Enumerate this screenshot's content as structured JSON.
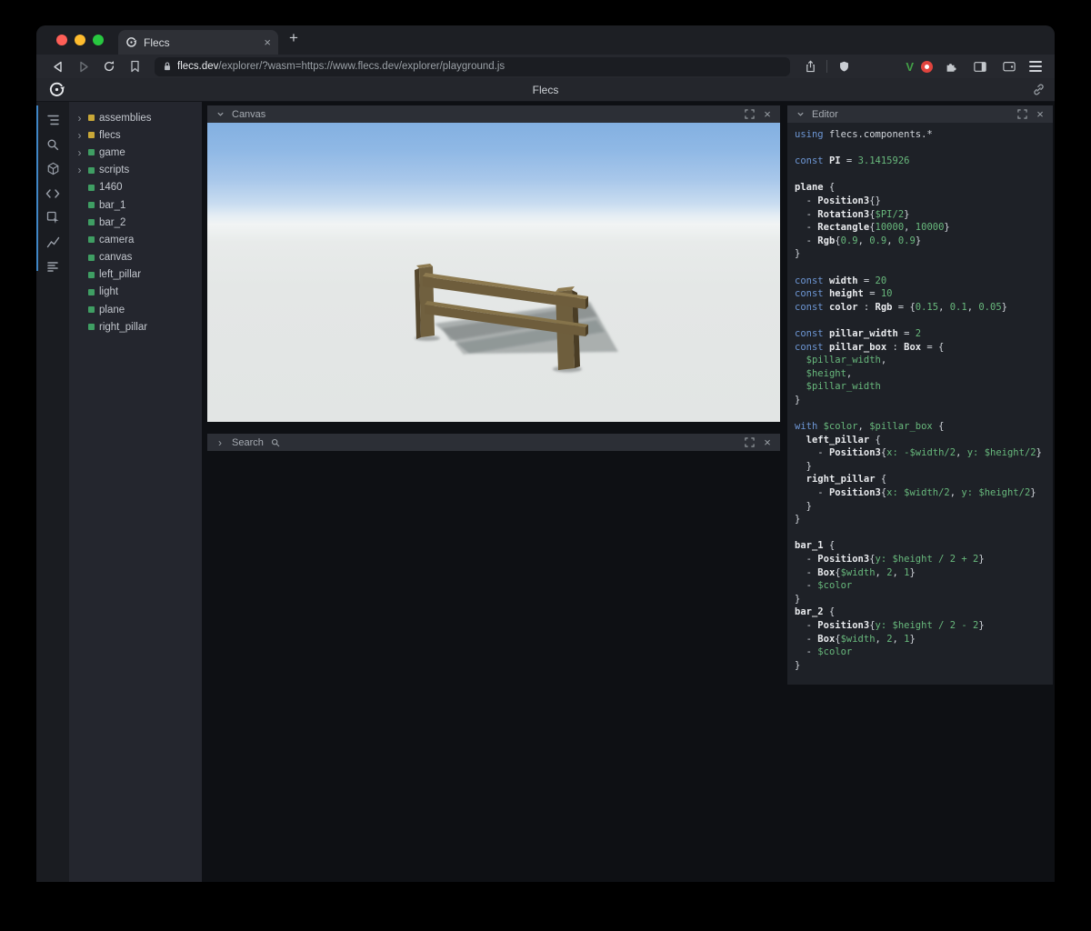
{
  "browser": {
    "tab_title": "Flecs",
    "url_host": "flecs.dev",
    "url_path": "/explorer/?wasm=https://www.flecs.dev/explorer/playground.js"
  },
  "glyphs": {
    "close": "×",
    "plus": "+",
    "chevron_right": "›"
  },
  "extensions": {
    "v_label": "V"
  },
  "header": {
    "title": "Flecs"
  },
  "sidebar_icon_names": [
    "outliner-icon",
    "search-icon",
    "entities-icon",
    "code-icon",
    "inspector-icon",
    "chart-icon",
    "stats-icon"
  ],
  "panels": {
    "canvas": {
      "title": "Canvas"
    },
    "search": {
      "title": "Search"
    },
    "editor": {
      "title": "Editor"
    }
  },
  "tree": {
    "items": [
      {
        "label": "assemblies",
        "color": "yellow",
        "expandable": true
      },
      {
        "label": "flecs",
        "color": "yellow",
        "expandable": true
      },
      {
        "label": "game",
        "color": "green",
        "expandable": true
      },
      {
        "label": "scripts",
        "color": "green",
        "expandable": true
      },
      {
        "label": "1460",
        "color": "green",
        "expandable": false
      },
      {
        "label": "bar_1",
        "color": "green",
        "expandable": false
      },
      {
        "label": "bar_2",
        "color": "green",
        "expandable": false
      },
      {
        "label": "camera",
        "color": "green",
        "expandable": false
      },
      {
        "label": "canvas",
        "color": "green",
        "expandable": false
      },
      {
        "label": "left_pillar",
        "color": "green",
        "expandable": false
      },
      {
        "label": "light",
        "color": "green",
        "expandable": false
      },
      {
        "label": "plane",
        "color": "green",
        "expandable": false
      },
      {
        "label": "right_pillar",
        "color": "green",
        "expandable": false
      }
    ]
  },
  "editor": {
    "lines": [
      [
        [
          "k",
          "using "
        ],
        [
          "p",
          "flecs.components.*"
        ]
      ],
      [],
      [
        [
          "k",
          "const "
        ],
        [
          "b",
          "PI"
        ],
        [
          "p",
          " = "
        ],
        [
          "v",
          "3.1415926"
        ]
      ],
      [],
      [
        [
          "b",
          "plane"
        ],
        [
          "p",
          " {"
        ]
      ],
      [
        [
          "p",
          "  - "
        ],
        [
          "b",
          "Position3"
        ],
        [
          "p",
          "{}"
        ]
      ],
      [
        [
          "p",
          "  - "
        ],
        [
          "b",
          "Rotation3"
        ],
        [
          "p",
          "{"
        ],
        [
          "v",
          "$PI/2"
        ],
        [
          "p",
          "}"
        ]
      ],
      [
        [
          "p",
          "  - "
        ],
        [
          "b",
          "Rectangle"
        ],
        [
          "p",
          "{"
        ],
        [
          "v",
          "10000"
        ],
        [
          "p",
          ", "
        ],
        [
          "v",
          "10000"
        ],
        [
          "p",
          "}"
        ]
      ],
      [
        [
          "p",
          "  - "
        ],
        [
          "b",
          "Rgb"
        ],
        [
          "p",
          "{"
        ],
        [
          "v",
          "0.9"
        ],
        [
          "p",
          ", "
        ],
        [
          "v",
          "0.9"
        ],
        [
          "p",
          ", "
        ],
        [
          "v",
          "0.9"
        ],
        [
          "p",
          "}"
        ]
      ],
      [
        [
          "p",
          "}"
        ]
      ],
      [],
      [
        [
          "k",
          "const "
        ],
        [
          "b",
          "width"
        ],
        [
          "p",
          " = "
        ],
        [
          "v",
          "20"
        ]
      ],
      [
        [
          "k",
          "const "
        ],
        [
          "b",
          "height"
        ],
        [
          "p",
          " = "
        ],
        [
          "v",
          "10"
        ]
      ],
      [
        [
          "k",
          "const "
        ],
        [
          "b",
          "color"
        ],
        [
          "p",
          " : "
        ],
        [
          "b",
          "Rgb"
        ],
        [
          "p",
          " = {"
        ],
        [
          "v",
          "0.15"
        ],
        [
          "p",
          ", "
        ],
        [
          "v",
          "0.1"
        ],
        [
          "p",
          ", "
        ],
        [
          "v",
          "0.05"
        ],
        [
          "p",
          "}"
        ]
      ],
      [],
      [
        [
          "k",
          "const "
        ],
        [
          "b",
          "pillar_width"
        ],
        [
          "p",
          " = "
        ],
        [
          "v",
          "2"
        ]
      ],
      [
        [
          "k",
          "const "
        ],
        [
          "b",
          "pillar_box"
        ],
        [
          "p",
          " : "
        ],
        [
          "b",
          "Box"
        ],
        [
          "p",
          " = {"
        ]
      ],
      [
        [
          "p",
          "  "
        ],
        [
          "v",
          "$pillar_width"
        ],
        [
          "p",
          ","
        ]
      ],
      [
        [
          "p",
          "  "
        ],
        [
          "v",
          "$height"
        ],
        [
          "p",
          ","
        ]
      ],
      [
        [
          "p",
          "  "
        ],
        [
          "v",
          "$pillar_width"
        ]
      ],
      [
        [
          "p",
          "}"
        ]
      ],
      [],
      [
        [
          "k",
          "with "
        ],
        [
          "v",
          "$color"
        ],
        [
          "p",
          ", "
        ],
        [
          "v",
          "$pillar_box"
        ],
        [
          "p",
          " {"
        ]
      ],
      [
        [
          "p",
          "  "
        ],
        [
          "b",
          "left_pillar"
        ],
        [
          "p",
          " {"
        ]
      ],
      [
        [
          "p",
          "    - "
        ],
        [
          "b",
          "Position3"
        ],
        [
          "p",
          "{"
        ],
        [
          "v",
          "x:"
        ],
        [
          "p",
          " "
        ],
        [
          "v",
          "-$width/2"
        ],
        [
          "p",
          ", "
        ],
        [
          "v",
          "y:"
        ],
        [
          "p",
          " "
        ],
        [
          "v",
          "$height/2"
        ],
        [
          "p",
          "}"
        ]
      ],
      [
        [
          "p",
          "  }"
        ]
      ],
      [
        [
          "p",
          "  "
        ],
        [
          "b",
          "right_pillar"
        ],
        [
          "p",
          " {"
        ]
      ],
      [
        [
          "p",
          "    - "
        ],
        [
          "b",
          "Position3"
        ],
        [
          "p",
          "{"
        ],
        [
          "v",
          "x:"
        ],
        [
          "p",
          " "
        ],
        [
          "v",
          "$width/2"
        ],
        [
          "p",
          ", "
        ],
        [
          "v",
          "y:"
        ],
        [
          "p",
          " "
        ],
        [
          "v",
          "$height/2"
        ],
        [
          "p",
          "}"
        ]
      ],
      [
        [
          "p",
          "  }"
        ]
      ],
      [
        [
          "p",
          "}"
        ]
      ],
      [],
      [
        [
          "b",
          "bar_1"
        ],
        [
          "p",
          " {"
        ]
      ],
      [
        [
          "p",
          "  - "
        ],
        [
          "b",
          "Position3"
        ],
        [
          "p",
          "{"
        ],
        [
          "v",
          "y:"
        ],
        [
          "p",
          " "
        ],
        [
          "v",
          "$height / 2 + 2"
        ],
        [
          "p",
          "}"
        ]
      ],
      [
        [
          "p",
          "  - "
        ],
        [
          "b",
          "Box"
        ],
        [
          "p",
          "{"
        ],
        [
          "v",
          "$width"
        ],
        [
          "p",
          ", "
        ],
        [
          "v",
          "2"
        ],
        [
          "p",
          ", "
        ],
        [
          "v",
          "1"
        ],
        [
          "p",
          "}"
        ]
      ],
      [
        [
          "p",
          "  - "
        ],
        [
          "v",
          "$color"
        ]
      ],
      [
        [
          "p",
          "}"
        ]
      ],
      [
        [
          "b",
          "bar_2"
        ],
        [
          "p",
          " {"
        ]
      ],
      [
        [
          "p",
          "  - "
        ],
        [
          "b",
          "Position3"
        ],
        [
          "p",
          "{"
        ],
        [
          "v",
          "y:"
        ],
        [
          "p",
          " "
        ],
        [
          "v",
          "$height / 2 - 2"
        ],
        [
          "p",
          "}"
        ]
      ],
      [
        [
          "p",
          "  - "
        ],
        [
          "b",
          "Box"
        ],
        [
          "p",
          "{"
        ],
        [
          "v",
          "$width"
        ],
        [
          "p",
          ", "
        ],
        [
          "v",
          "2"
        ],
        [
          "p",
          ", "
        ],
        [
          "v",
          "1"
        ],
        [
          "p",
          "}"
        ]
      ],
      [
        [
          "p",
          "  - "
        ],
        [
          "v",
          "$color"
        ]
      ],
      [
        [
          "p",
          "}"
        ]
      ]
    ]
  },
  "colors": {
    "tree_yellow": "#c9a838",
    "tree_green": "#3f9e63",
    "keyword_blue": "#6d96d4",
    "value_green": "#68b87c",
    "traffic_red": "#ff5f57",
    "traffic_yellow": "#febc2e",
    "traffic_green": "#28c840",
    "vimium_green": "#43a047",
    "record_red": "#e0443e"
  }
}
